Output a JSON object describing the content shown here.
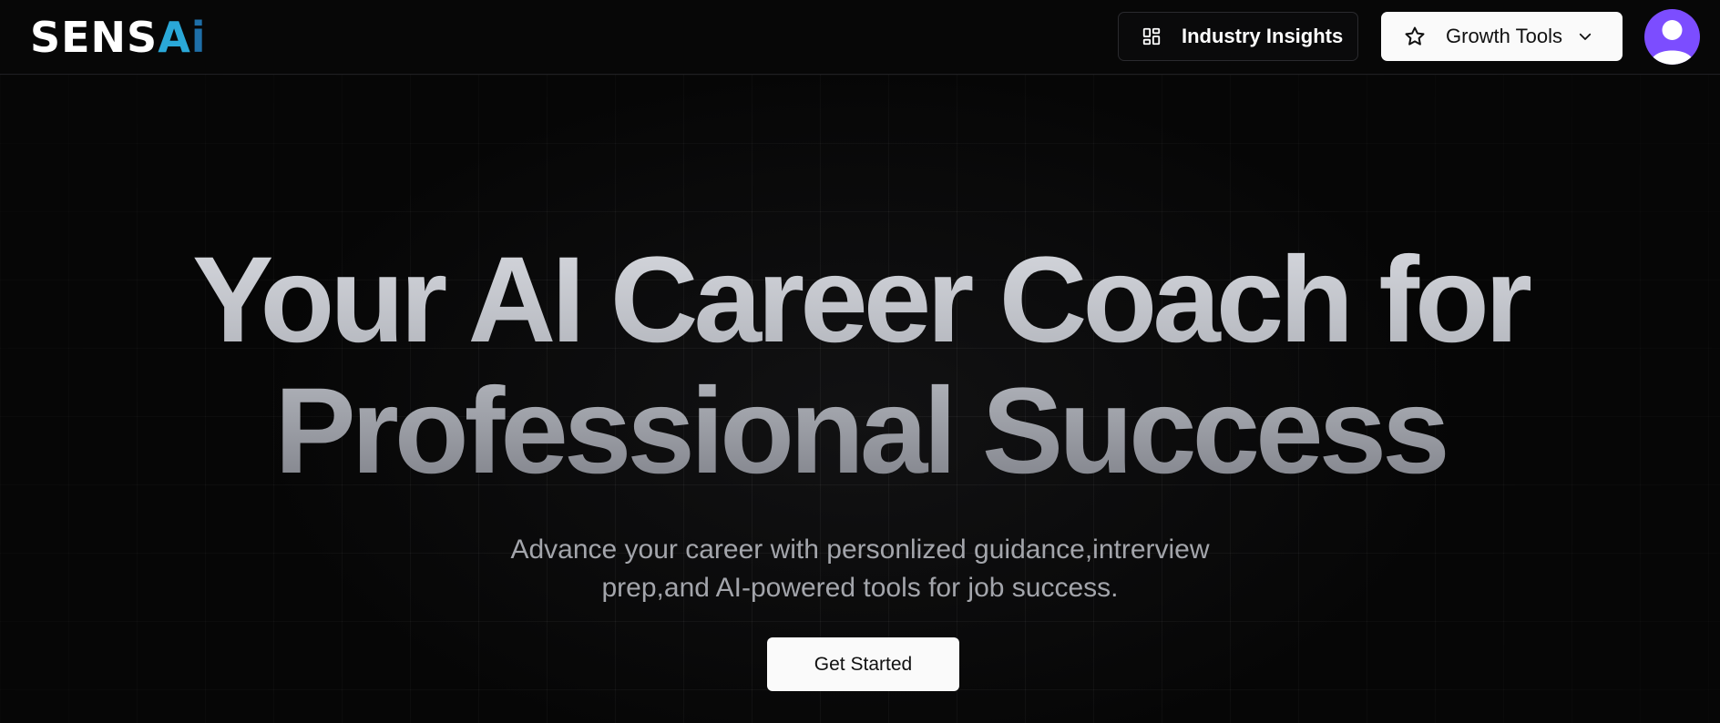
{
  "header": {
    "logo_main": "SENS",
    "logo_accent": "A",
    "logo_tail": "i",
    "nav": {
      "industry_insights_label": "Industry Insights",
      "industry_insights_icon": "layout-dashboard-icon",
      "growth_tools_label": "Growth Tools",
      "growth_tools_icon": "star-icon",
      "growth_tools_chevron": "chevron-down-icon"
    },
    "avatar_icon": "user-avatar-icon"
  },
  "hero": {
    "title_line1": "Your AI Career Coach for",
    "title_line2": "Professional Success",
    "subtitle_line1": "Advance your career with personlized guidance,intrerview",
    "subtitle_line2": "prep,and AI-powered tools for job success.",
    "cta_label": "Get Started"
  },
  "colors": {
    "background": "#060606",
    "button_light": "#fafafa",
    "avatar": "#7c4dff",
    "logo_accent": "#2aa8d8",
    "subtitle_text": "#a3a5ab"
  }
}
